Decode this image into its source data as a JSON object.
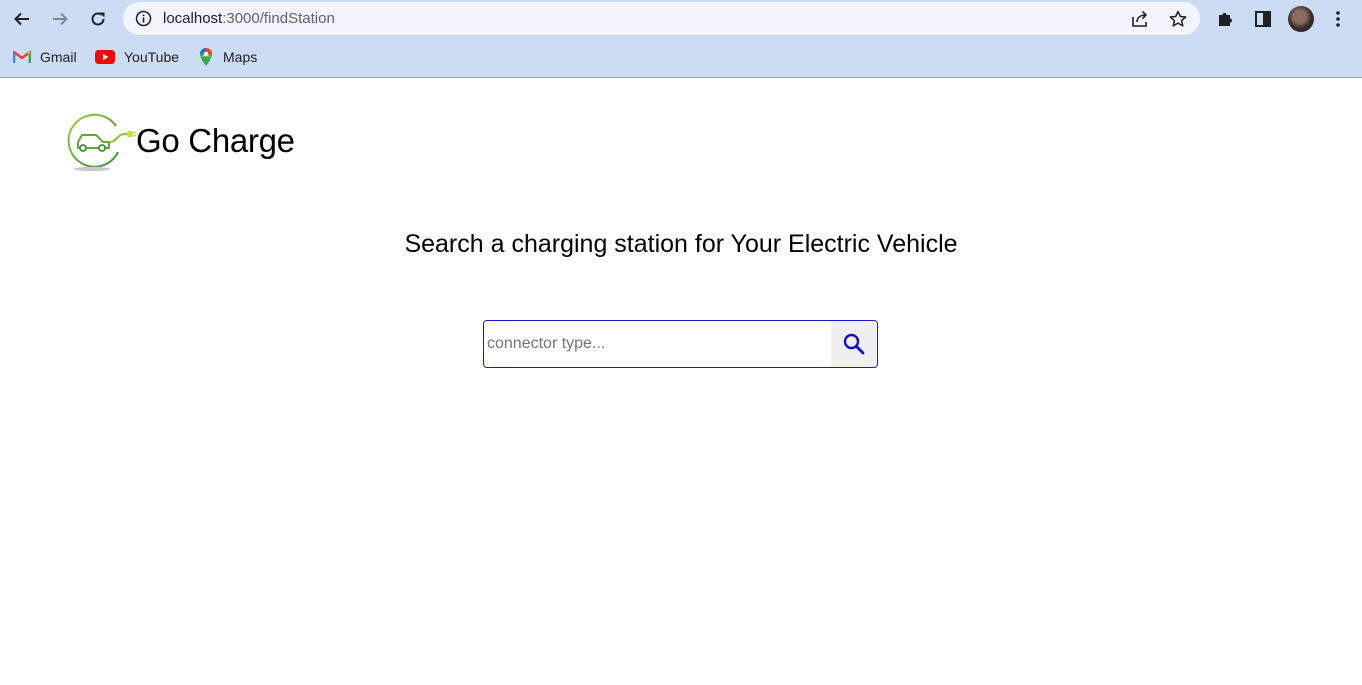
{
  "browser": {
    "url_host": "localhost",
    "url_path": ":3000/findStation",
    "bookmarks": [
      {
        "label": "Gmail",
        "icon": "gmail-icon"
      },
      {
        "label": "YouTube",
        "icon": "youtube-icon"
      },
      {
        "label": "Maps",
        "icon": "maps-icon"
      }
    ]
  },
  "page": {
    "brand": "Go Charge",
    "headline": "Search a charging station for Your Electric Vehicle",
    "search": {
      "placeholder": "connector type...",
      "value": "",
      "button_icon": "search-icon"
    }
  },
  "colors": {
    "chrome": "#cddcf5",
    "search_border": "#1a1ad4",
    "search_icon": "#1010c8",
    "logo_green": "#5fa83a"
  }
}
